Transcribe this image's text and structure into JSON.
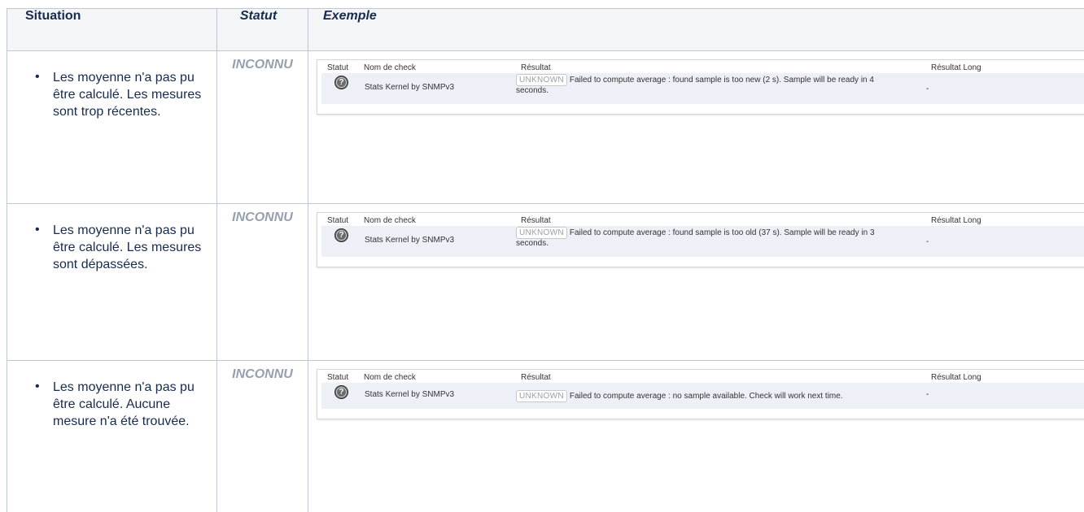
{
  "headers": {
    "situation": "Situation",
    "statut": "Statut",
    "exemple": "Exemple"
  },
  "rows": [
    {
      "situation": "Les moyenne n'a pas pu être calculé. Les mesures sont trop récentes.",
      "statut": "INCONNU",
      "example": {
        "col_statut": "Statut",
        "col_nom": "Nom de check",
        "col_resultat": "Résultat",
        "col_long": "Résultat Long",
        "check_name": "Stats Kernel by SNMPv3",
        "badge": "UNKNOWN",
        "result": "Failed to compute average : found sample is too new (2 s). Sample will be ready in 4 seconds.",
        "long": "-"
      }
    },
    {
      "situation": "Les moyenne n'a pas pu être calculé. Les mesures sont dépassées.",
      "statut": "INCONNU",
      "example": {
        "col_statut": "Statut",
        "col_nom": "Nom de check",
        "col_resultat": "Résultat",
        "col_long": "Résultat Long",
        "check_name": "Stats Kernel by SNMPv3",
        "badge": "UNKNOWN",
        "result": "Failed to compute average : found sample is too old (37 s). Sample will be ready in 3 seconds.",
        "long": "-"
      }
    },
    {
      "situation": "Les moyenne n'a pas pu être calculé. Aucune mesure n'a été trouvée.",
      "statut": "INCONNU",
      "example": {
        "col_statut": "Statut",
        "col_nom": "Nom de check",
        "col_resultat": "Résultat",
        "col_long": "Résultat Long",
        "check_name": "Stats Kernel by SNMPv3",
        "badge": "UNKNOWN",
        "result": "Failed to compute average : no sample available. Check will work next time.",
        "long": "-"
      }
    }
  ],
  "icons": {
    "status_unknown": "question-circle-icon",
    "bullet": "bullet-icon"
  },
  "colors": {
    "status_text": "#97a0af",
    "header_bg": "#f4f5f7",
    "row_bg": "#eef0f8",
    "border": "#c1c7d0"
  }
}
